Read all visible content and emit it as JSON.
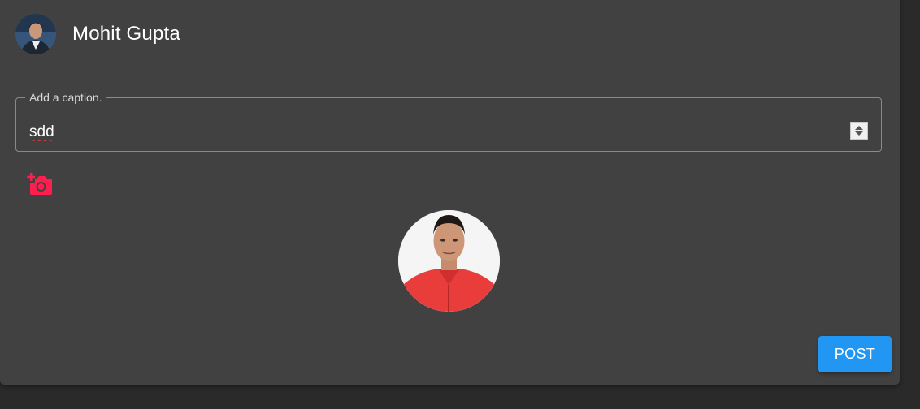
{
  "post_card": {
    "user": {
      "name": "Mohit Gupta"
    },
    "caption": {
      "label": "Add a caption.",
      "value": "sdd"
    },
    "post_label": "POST"
  },
  "colors": {
    "card_background": "#414141",
    "page_background": "#2a2a2a",
    "accent_icon": "#ff1f4f",
    "post_button": "#2196f3"
  },
  "icons": {
    "add_photo": "add-a-photo-icon"
  }
}
